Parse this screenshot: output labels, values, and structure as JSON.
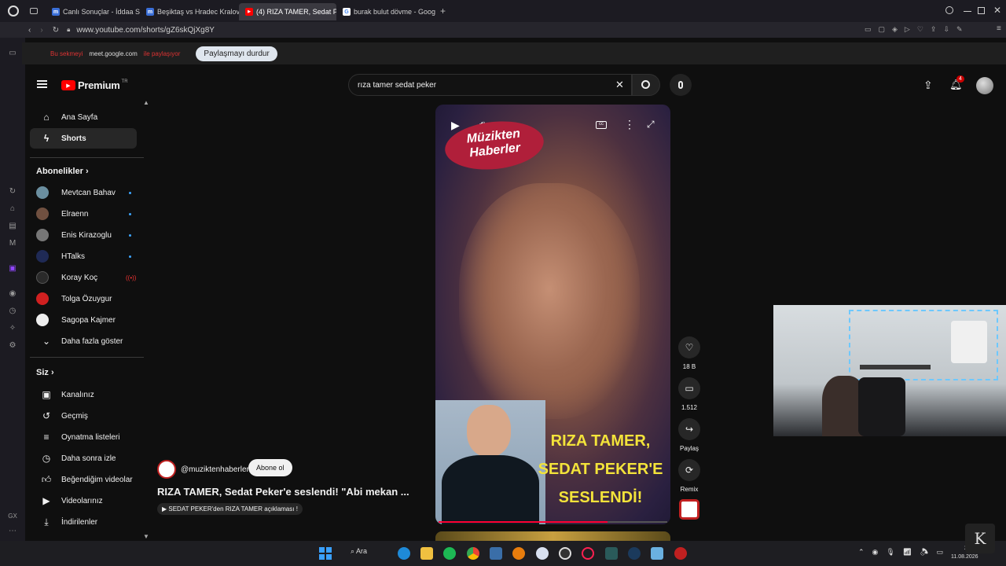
{
  "browser": {
    "tabs": [
      {
        "label": "Canlı Sonuçlar - İddaa Son",
        "icon_color": "#3a6fd8",
        "icon": "m"
      },
      {
        "label": "Beşiktaş vs Hradec Kralove",
        "icon_color": "#3a6fd8",
        "icon": "m"
      },
      {
        "label": "(4) RIZA TAMER, Sedat Pe",
        "icon_color": "#ff0000",
        "icon": "▶",
        "active": true
      },
      {
        "label": "burak bulut dövme - Googl",
        "icon_color": "#4285f4",
        "icon": "G"
      }
    ],
    "url": "www.youtube.com/shorts/gZ6skQjXg8Y",
    "share": {
      "prefix": "Bu sekmeyi",
      "host": "meet.google.com",
      "suffix": "ile paylaşıyor",
      "stop_button": "Paylaşmayı durdur"
    }
  },
  "youtube": {
    "logo": "Premium",
    "logo_sup": "TR",
    "search_value": "rıza tamer sedat peker",
    "notifications_badge": "4",
    "sidebar": {
      "main": [
        {
          "label": "Ana Sayfa",
          "icon": "home-icon"
        },
        {
          "label": "Shorts",
          "icon": "shorts-icon",
          "active": true
        }
      ],
      "subs_header": "Abonelikler",
      "subscriptions": [
        {
          "label": "Mevtcan Bahav",
          "color": "#6b8fa0",
          "dot": true
        },
        {
          "label": "Elraenn",
          "color": "#705040",
          "dot": true
        },
        {
          "label": "Enis Kirazoglu",
          "color": "#777777",
          "dot": true
        },
        {
          "label": "HTalks",
          "color": "#1f2a55",
          "dot": true
        },
        {
          "label": "Koray Koç",
          "color": "#2a2a2a",
          "live": true
        },
        {
          "label": "Tolga Özuygur",
          "color": "#d02020"
        },
        {
          "label": "Sagopa Kajmer",
          "color": "#eeeeee"
        }
      ],
      "show_more": "Daha fazla göster",
      "you_header": "Siz",
      "you_items": [
        {
          "label": "Kanalınız",
          "icon": "channel-icon"
        },
        {
          "label": "Geçmiş",
          "icon": "history-icon"
        },
        {
          "label": "Oynatma listeleri",
          "icon": "playlist-icon"
        },
        {
          "label": "Daha sonra izle",
          "icon": "clock-icon"
        },
        {
          "label": "Beğendiğim videolar",
          "icon": "like-icon"
        },
        {
          "label": "Videolarınız",
          "icon": "video-icon"
        },
        {
          "label": "İndirilenler",
          "icon": "download-icon"
        }
      ]
    },
    "short": {
      "channel": "@muziktenhaberler",
      "subscribe": "Abone ol",
      "title": "RIZA TAMER, Sedat Peker'e seslendi! \"Abi mekan ...",
      "playlist": "SEDAT PEKER'den RIZA TAMER açıklaması !",
      "brand_line1": "Müzikten",
      "brand_line2": "Haberler",
      "caption_lines": [
        "RIZA TAMER,",
        "SEDAT PEKER'E",
        "SESLENDİ!"
      ],
      "likes": "18 B",
      "comments": "1.512",
      "share": "Paylaş",
      "remix": "Remix",
      "progress": 0.74
    }
  },
  "taskbar": {
    "search": "Ara",
    "clock_time": "23:53",
    "clock_date": "11.08.2026"
  },
  "rail": {
    "label": "GX"
  }
}
